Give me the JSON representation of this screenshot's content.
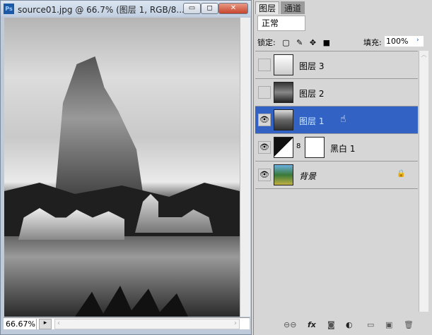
{
  "document": {
    "title": "source01.jpg @ 66.7% (图层 1, RGB/8...",
    "app_icon": "Ps",
    "zoom": "66.67%"
  },
  "window_buttons": {
    "minimize": "▭",
    "maximize": "◻",
    "close": "✕"
  },
  "panel": {
    "tabs": [
      {
        "label": "图层"
      },
      {
        "label": "通道"
      }
    ],
    "blend_mode": "正常",
    "lock_label": "锁定:",
    "fill_label": "填充:",
    "fill_value": "100%",
    "layers": [
      {
        "name": "图层 3",
        "visible": false
      },
      {
        "name": "图层 2",
        "visible": false
      },
      {
        "name": "图层 1",
        "visible": true,
        "selected": true
      },
      {
        "name": "黑白 1",
        "visible": true
      },
      {
        "name": "背景",
        "visible": true,
        "locked": true
      }
    ],
    "icons": {
      "eye": "👁",
      "lock": "🔒",
      "chain": "8"
    },
    "bottom_icons": {
      "link": "⊖⊖",
      "fx": "fx",
      "mask": "◙",
      "adjust": "◐",
      "group": "▭",
      "new": "▣",
      "trash": "🗑"
    }
  }
}
